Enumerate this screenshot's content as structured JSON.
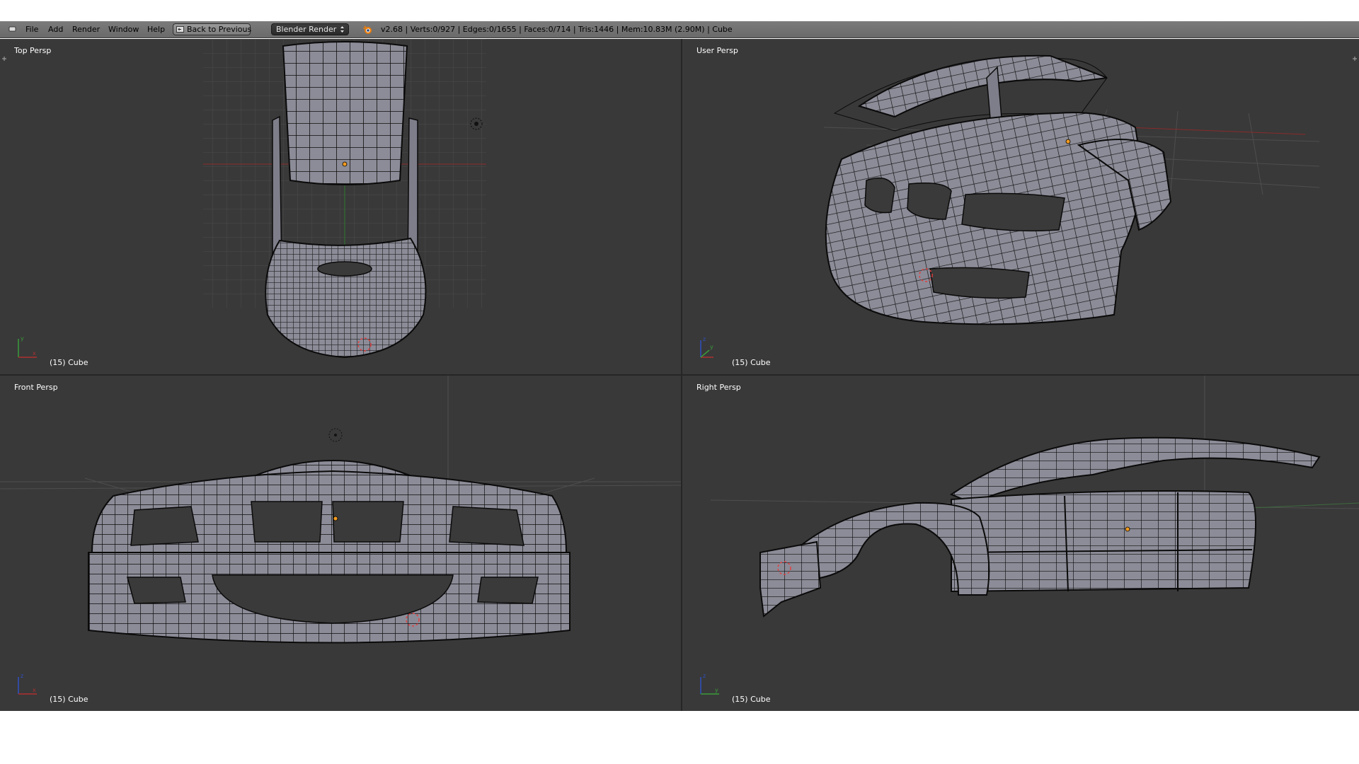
{
  "menubar": {
    "editor_icon": "info-editor-icon",
    "menus": [
      "File",
      "Add",
      "Render",
      "Window",
      "Help"
    ],
    "back_button": {
      "label": "Back to Previous",
      "icon": "screen-back-icon"
    },
    "render_engine": {
      "selected": "Blender Render"
    },
    "logo_icon": "blender-logo-icon",
    "stats": "v2.68 | Verts:0/927 | Edges:0/1655 | Faces:0/714 | Tris:1446 | Mem:10.83M (2.90M) | Cube"
  },
  "viewports": [
    {
      "title": "Top Persp",
      "object_label": "(15) Cube"
    },
    {
      "title": "User Persp",
      "object_label": "(15) Cube"
    },
    {
      "title": "Front Persp",
      "object_label": "(15) Cube"
    },
    {
      "title": "Right Persp",
      "object_label": "(15) Cube"
    }
  ],
  "colors": {
    "viewport_bg": "#393939",
    "mesh_face": "#8c8c98",
    "wire": "#0a0a0a",
    "grid": "#4a4a4a",
    "axis_x": "#b03030",
    "axis_y": "#3a9a3a",
    "axis_z": "#3050c0",
    "origin": "#f09a20"
  }
}
